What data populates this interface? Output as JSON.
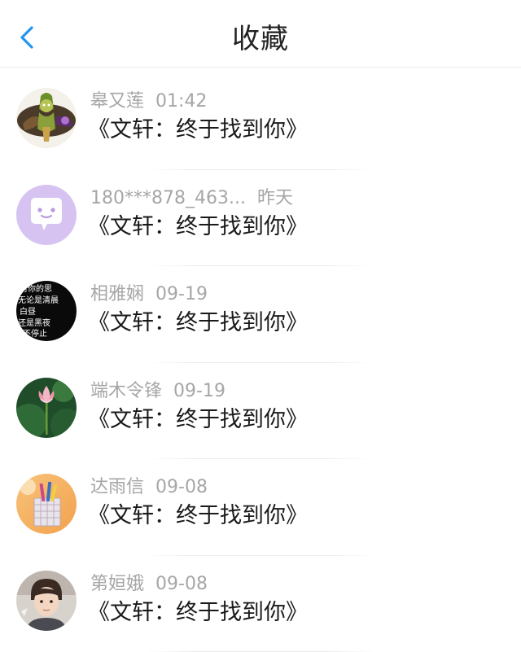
{
  "header": {
    "title": "收藏",
    "back_icon": "chevron-left-icon",
    "accent_color": "#2196f3"
  },
  "favorites": [
    {
      "user": "皋又莲",
      "time": "01:42",
      "title": "《文轩：终于找到你》",
      "avatar": "game-character-avatar"
    },
    {
      "user": "180***878_463...",
      "time": "昨天",
      "title": "《文轩：终于找到你》",
      "avatar": "chat-bubble-avatar"
    },
    {
      "user": "相雅娴",
      "time": "09-19",
      "title": "《文轩：终于找到你》",
      "avatar": "text-quote-avatar",
      "avatar_text": [
        "对你的思",
        "无论是清晨",
        "白昼",
        "还是黑夜",
        "不停止"
      ]
    },
    {
      "user": "端木令锋",
      "time": "09-19",
      "title": "《文轩：终于找到你》",
      "avatar": "lotus-flower-avatar"
    },
    {
      "user": "达雨信",
      "time": "09-08",
      "title": "《文轩：终于找到你》",
      "avatar": "pen-holder-avatar"
    },
    {
      "user": "第姮娥",
      "time": "09-08",
      "title": "《文轩：终于找到你》",
      "avatar": "boy-portrait-avatar"
    }
  ]
}
